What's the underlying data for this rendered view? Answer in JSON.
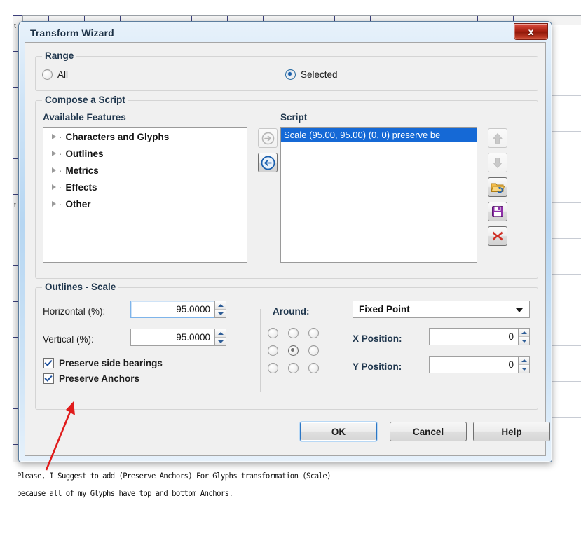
{
  "background": {
    "ruler_tick_labels": [
      "t",
      "t"
    ]
  },
  "dialog": {
    "title": "Transform Wizard",
    "close_button": "x",
    "close_icon": "close-icon"
  },
  "range": {
    "legend": "Range",
    "options": [
      {
        "label": "All",
        "selected": false
      },
      {
        "label": "Selected",
        "selected": true
      }
    ]
  },
  "compose": {
    "legend": "Compose a Script",
    "available_label": "Available Features",
    "script_label": "Script",
    "features": [
      {
        "label": "Characters and Glyphs",
        "expandable": true
      },
      {
        "label": "Outlines",
        "expandable": true
      },
      {
        "label": "Metrics",
        "expandable": true
      },
      {
        "label": "Effects",
        "expandable": true
      },
      {
        "label": "Other",
        "expandable": true
      }
    ],
    "script_items": [
      {
        "text": "Scale (95.00, 95.00) (0, 0) preserve be",
        "selected": true
      }
    ],
    "transfer_buttons": [
      {
        "name": "add-feature-button",
        "icon": "arrow-right-circle-icon",
        "enabled": false
      },
      {
        "name": "remove-feature-button",
        "icon": "arrow-left-circle-icon",
        "enabled": true
      }
    ],
    "side_buttons": [
      {
        "name": "move-up-button",
        "icon": "arrow-up-icon",
        "enabled": false
      },
      {
        "name": "move-down-button",
        "icon": "arrow-down-icon",
        "enabled": false
      },
      {
        "name": "open-script-button",
        "icon": "folder-open-icon",
        "enabled": true
      },
      {
        "name": "save-script-button",
        "icon": "floppy-disk-icon",
        "enabled": true
      },
      {
        "name": "delete-script-button",
        "icon": "red-x-icon",
        "enabled": true
      }
    ]
  },
  "scale": {
    "legend": "Outlines - Scale",
    "horizontal_label": "Horizontal (%):",
    "horizontal_value": "95.0000",
    "vertical_label": "Vertical (%):",
    "vertical_value": "95.0000",
    "preserve_side_bearings": {
      "label": "Preserve side bearings",
      "checked": true
    },
    "preserve_anchors": {
      "label": "Preserve Anchors",
      "checked": true
    },
    "around_label": "Around:",
    "around_value": "Fixed Point",
    "around_options": [
      "Fixed Point"
    ],
    "anchor_grid_selected_index": 4,
    "x_position_label": "X Position:",
    "x_position_value": "0",
    "y_position_label": "Y Position:",
    "y_position_value": "0"
  },
  "footer": {
    "ok": "OK",
    "cancel": "Cancel",
    "help": "Help"
  },
  "annotation": {
    "line1": "Please, I Suggest to add (Preserve Anchors) For Glyphs transformation (Scale)",
    "line2": "because all of my Glyphs have top and bottom Anchors.",
    "arrow_color": "#e01b1b"
  }
}
